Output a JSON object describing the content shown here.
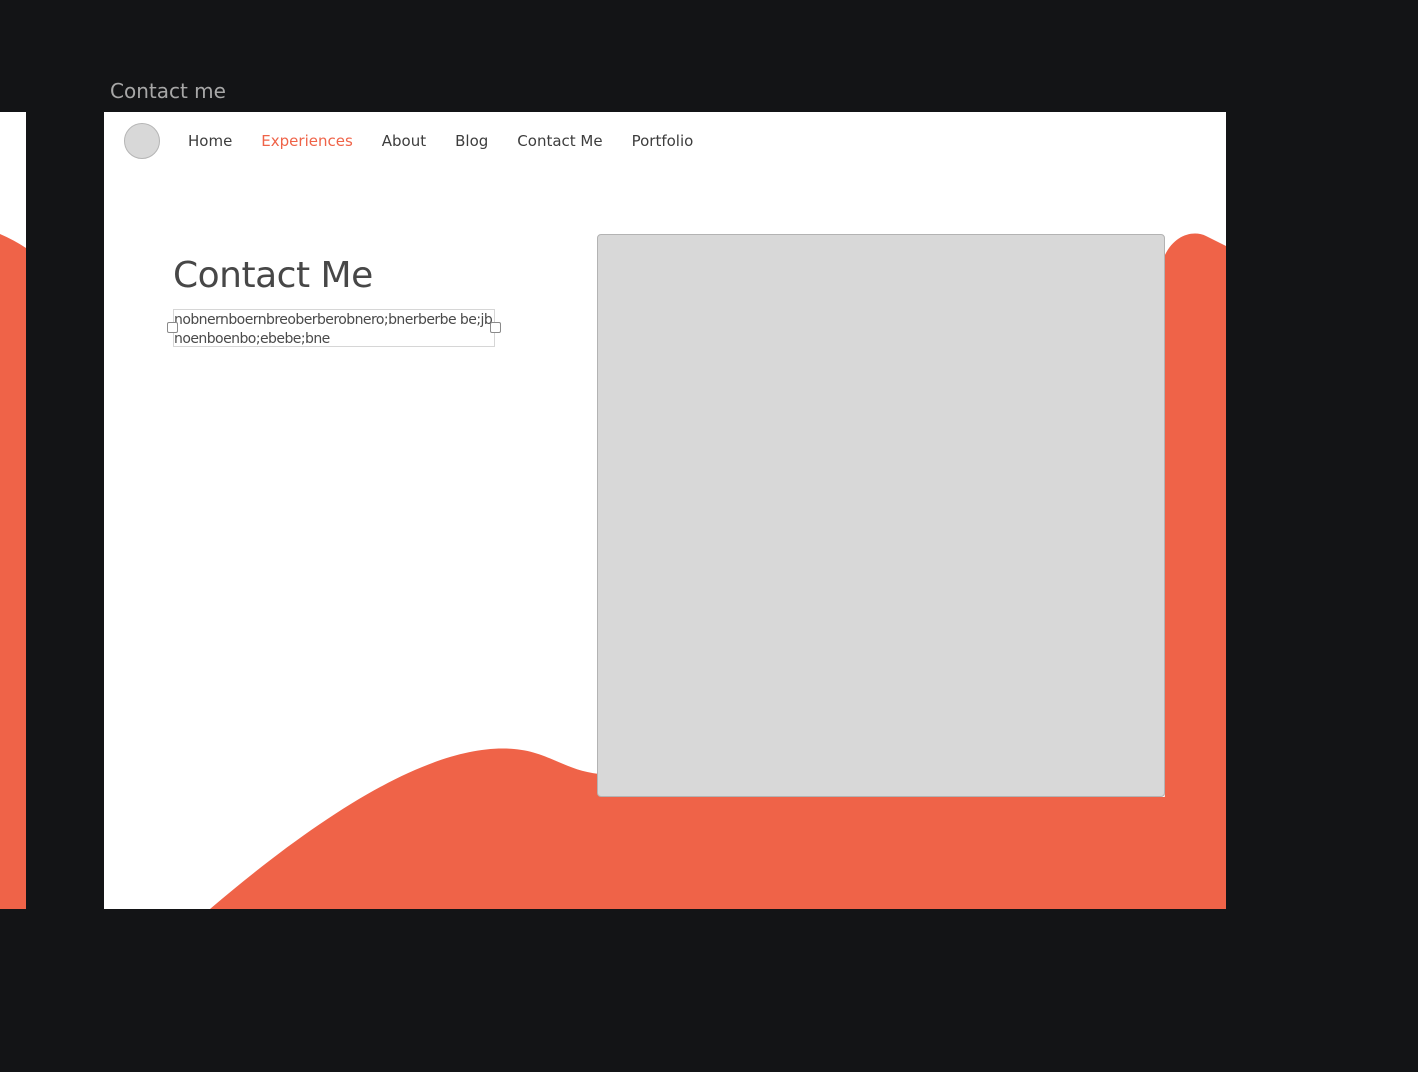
{
  "artboard": {
    "label": "Contact me"
  },
  "nav": {
    "items": [
      {
        "label": "Home"
      },
      {
        "label": "Experiences",
        "active": true
      },
      {
        "label": "About"
      },
      {
        "label": "Blog"
      },
      {
        "label": "Contact Me"
      },
      {
        "label": "Portfolio"
      }
    ]
  },
  "content": {
    "title": "Contact Me",
    "body_text": "nobnernboernbreoberberobnero;bnerberbe be;jbnoenboenbo;ebebe;bne"
  },
  "colors": {
    "background": "#131416",
    "accent": "#ef6348",
    "placeholder": "#d8d8d8",
    "text": "#474747"
  }
}
